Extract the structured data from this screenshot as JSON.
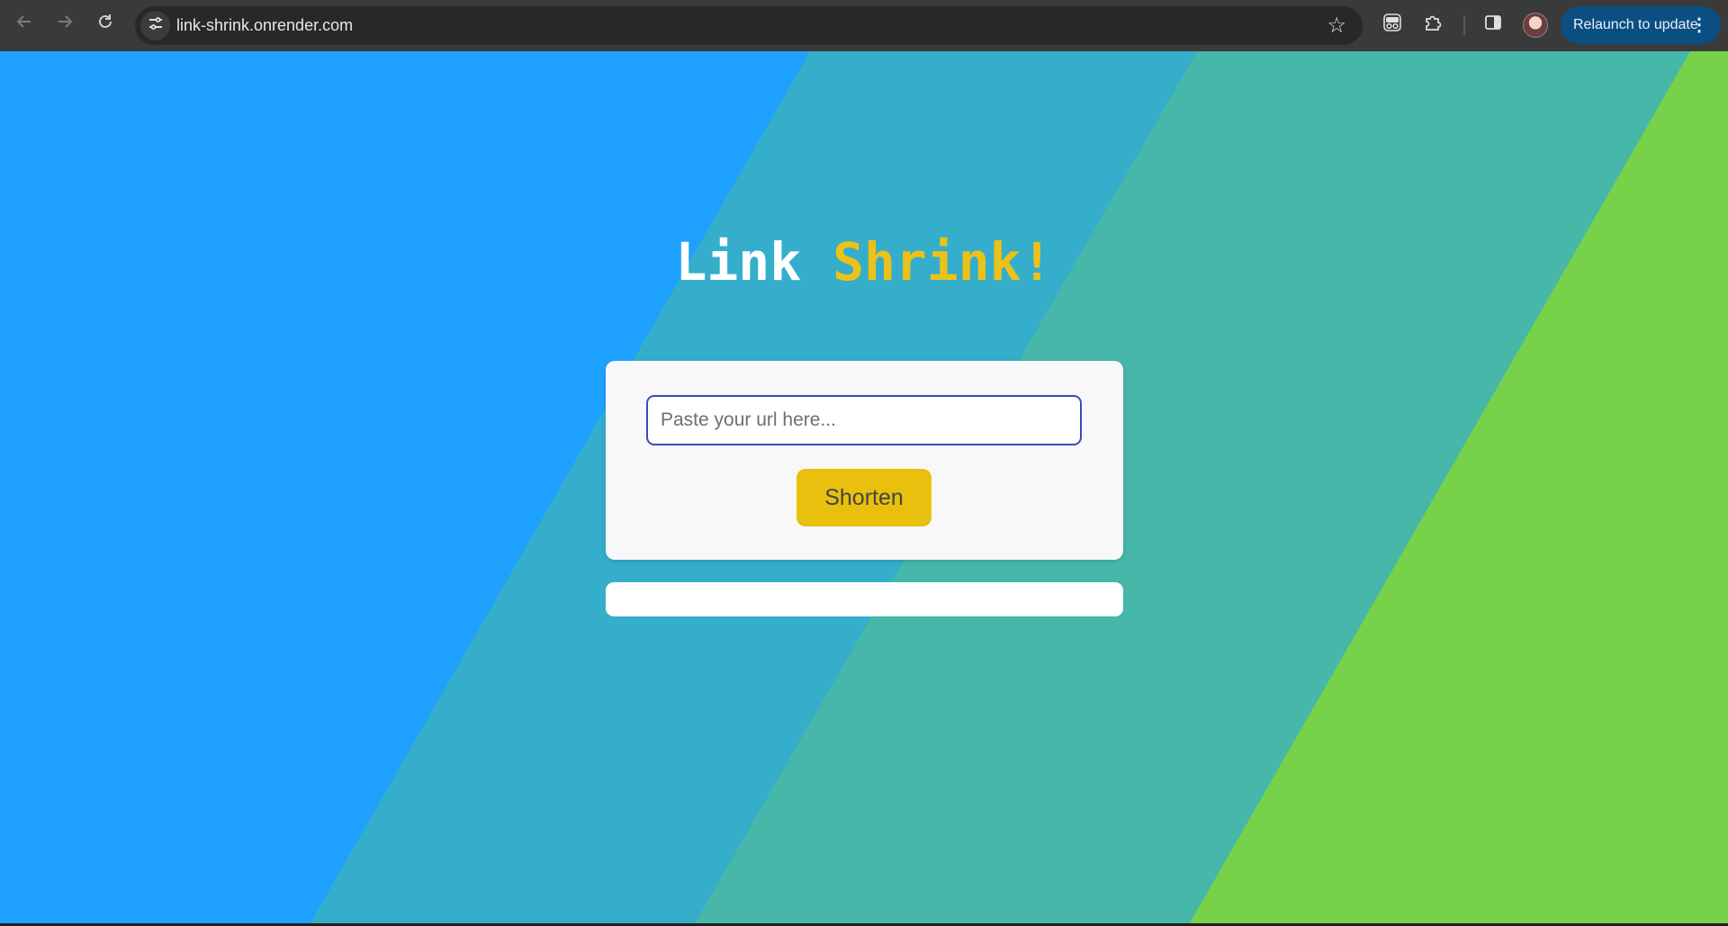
{
  "browser": {
    "url": "link-shrink.onrender.com",
    "relaunch_label": "Relaunch to update",
    "icons": {
      "back": "arrow-left-icon",
      "forward": "arrow-right-icon",
      "reload": "reload-icon",
      "site_info": "tune-icon",
      "bookmark": "star-icon",
      "extension1": "incognito-glasses-icon",
      "extensions": "puzzle-piece-icon",
      "side_panel": "side-panel-icon",
      "menu": "kebab-menu-icon"
    },
    "colors": {
      "toolbar": "#3a3a3a",
      "omnibox": "#282828",
      "relaunch": "#0b4f82"
    }
  },
  "app": {
    "title_part1": "Link",
    "title_part2": "Shrink!",
    "input_placeholder": "Paste your url here...",
    "input_value": "",
    "shorten_label": "Shorten",
    "result_text": "",
    "colors": {
      "bg_blue": "#1ea1ff",
      "bg_teal": "#34aecb",
      "bg_teal_green": "#46b7a9",
      "bg_green": "#77d24a",
      "accent_yellow": "#ecc119",
      "button_yellow": "#e8c00d",
      "input_border": "#3a4bb5"
    }
  }
}
